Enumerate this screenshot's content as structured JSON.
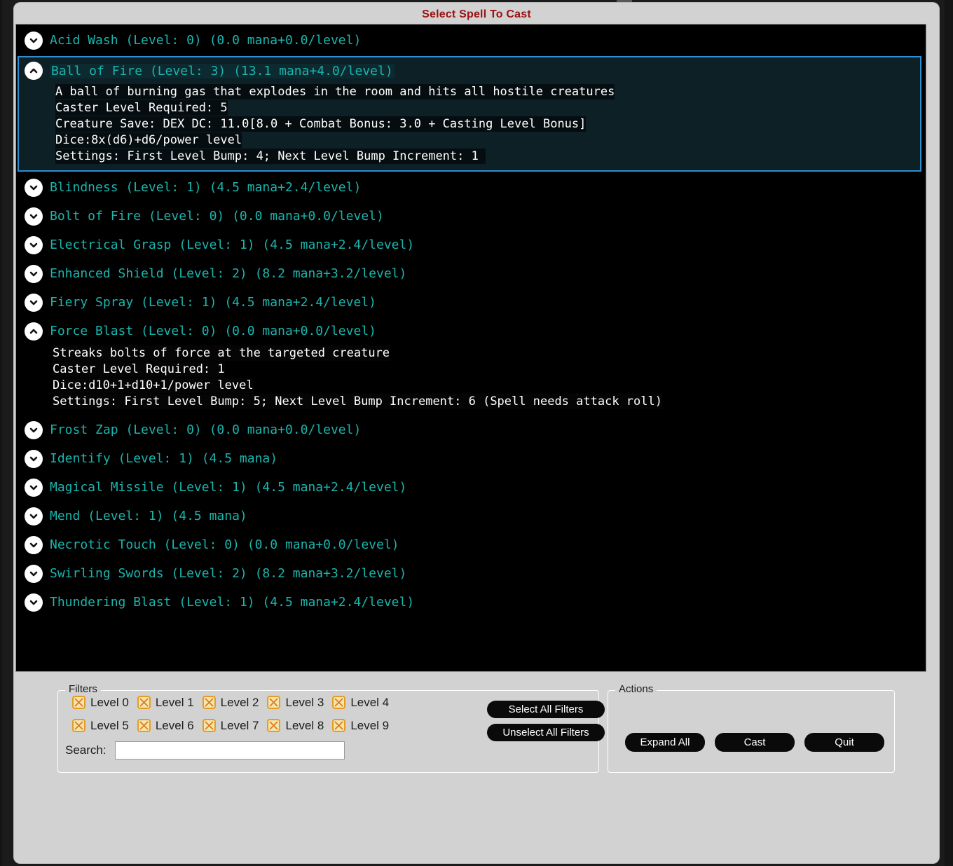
{
  "window": {
    "title": "Select Spell To Cast",
    "title_color": "#9b1010"
  },
  "colors": {
    "spell_title": "#1ab5ad",
    "detail_text": "#ffffff",
    "selection_border": "#2e8ed0",
    "checkbox_border": "#e79b23",
    "checkbox_fill": "#f2e6b0",
    "list_background": "#000000",
    "dialog_background": "#d2d2d2",
    "button_background": "#0a0a0a"
  },
  "spell_list": {
    "items": [
      {
        "title": "Acid Wash (Level: 0) (0.0 mana+0.0/level)",
        "expanded": false,
        "selected": false,
        "icon": "chevron-down-icon",
        "details": []
      },
      {
        "title": "Ball of Fire (Level: 3) (13.1 mana+4.0/level)",
        "expanded": true,
        "selected": true,
        "icon": "chevron-up-icon",
        "details": [
          "A ball of burning gas that explodes in the room and hits all hostile creatures",
          "Caster Level Required: 5",
          "Creature Save: DEX DC: 11.0[8.0 + Combat Bonus: 3.0 + Casting Level Bonus]",
          "Dice:8x(d6)+d6/power level",
          "Settings: First Level Bump: 4; Next Level Bump Increment: 1 "
        ]
      },
      {
        "title": "Blindness (Level: 1) (4.5 mana+2.4/level)",
        "expanded": false,
        "selected": false,
        "icon": "chevron-down-icon",
        "details": []
      },
      {
        "title": "Bolt of Fire (Level: 0) (0.0 mana+0.0/level)",
        "expanded": false,
        "selected": false,
        "icon": "chevron-down-icon",
        "details": []
      },
      {
        "title": "Electrical Grasp (Level: 1) (4.5 mana+2.4/level)",
        "expanded": false,
        "selected": false,
        "icon": "chevron-down-icon",
        "details": []
      },
      {
        "title": "Enhanced Shield (Level: 2) (8.2 mana+3.2/level)",
        "expanded": false,
        "selected": false,
        "icon": "chevron-down-icon",
        "details": []
      },
      {
        "title": "Fiery Spray (Level: 1) (4.5 mana+2.4/level)",
        "expanded": false,
        "selected": false,
        "icon": "chevron-down-icon",
        "details": []
      },
      {
        "title": "Force Blast (Level: 0) (0.0 mana+0.0/level)",
        "expanded": true,
        "selected": false,
        "icon": "chevron-up-icon",
        "details": [
          "Streaks bolts of force at the targeted creature",
          "Caster Level Required: 1",
          "Dice:d10+1+d10+1/power level",
          "Settings: First Level Bump: 5; Next Level Bump Increment: 6 (Spell needs attack roll)"
        ]
      },
      {
        "title": "Frost Zap (Level: 0) (0.0 mana+0.0/level)",
        "expanded": false,
        "selected": false,
        "icon": "chevron-down-icon",
        "details": []
      },
      {
        "title": "Identify (Level: 1) (4.5 mana)",
        "expanded": false,
        "selected": false,
        "icon": "chevron-down-icon",
        "details": []
      },
      {
        "title": "Magical Missile (Level: 1) (4.5 mana+2.4/level)",
        "expanded": false,
        "selected": false,
        "icon": "chevron-down-icon",
        "details": []
      },
      {
        "title": "Mend (Level: 1) (4.5 mana)",
        "expanded": false,
        "selected": false,
        "icon": "chevron-down-icon",
        "details": []
      },
      {
        "title": "Necrotic Touch (Level: 0) (0.0 mana+0.0/level)",
        "expanded": false,
        "selected": false,
        "icon": "chevron-down-icon",
        "details": []
      },
      {
        "title": "Swirling Swords (Level: 2) (8.2 mana+3.2/level)",
        "expanded": false,
        "selected": false,
        "icon": "chevron-down-icon",
        "details": []
      },
      {
        "title": "Thundering Blast (Level: 1) (4.5 mana+2.4/level)",
        "expanded": false,
        "selected": false,
        "icon": "chevron-down-icon",
        "details": []
      }
    ]
  },
  "filters": {
    "label": "Filters",
    "checkboxes": [
      {
        "label": "Level 0",
        "checked": true
      },
      {
        "label": "Level 1",
        "checked": true
      },
      {
        "label": "Level 2",
        "checked": true
      },
      {
        "label": "Level 3",
        "checked": true
      },
      {
        "label": "Level 4",
        "checked": true
      },
      {
        "label": "Level 5",
        "checked": true
      },
      {
        "label": "Level 6",
        "checked": true
      },
      {
        "label": "Level 7",
        "checked": true
      },
      {
        "label": "Level 8",
        "checked": true
      },
      {
        "label": "Level 9",
        "checked": true
      }
    ],
    "search_label": "Search:",
    "search_value": "",
    "search_placeholder": "",
    "select_all_label": "Select All Filters",
    "unselect_all_label": "Unselect All Filters"
  },
  "actions": {
    "label": "Actions",
    "expand_all_label": "Expand All",
    "cast_label": "Cast",
    "quit_label": "Quit"
  }
}
